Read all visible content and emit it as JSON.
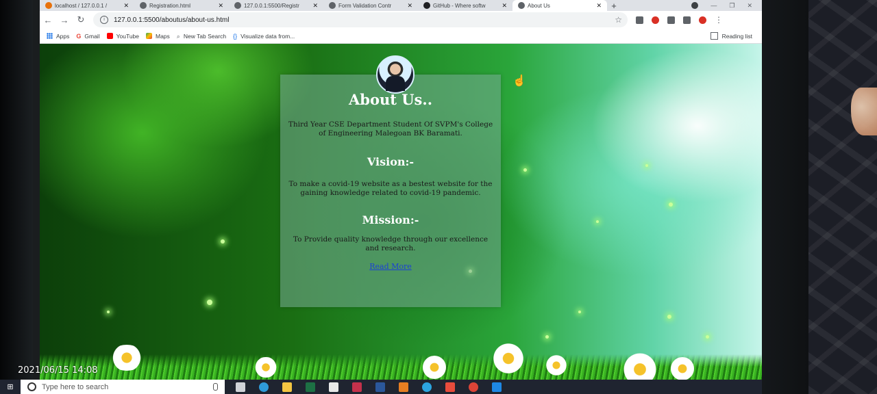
{
  "browser": {
    "tabs": [
      {
        "label": "localhost / 127.0.0.1 /",
        "active": false
      },
      {
        "label": "Registration.html",
        "active": false
      },
      {
        "label": "127.0.0.1:5500/Registr",
        "active": false
      },
      {
        "label": "Form Validation Contr",
        "active": false
      },
      {
        "label": "GitHub - Where softw",
        "active": false
      },
      {
        "label": "About Us",
        "active": true
      }
    ],
    "new_tab": "+",
    "url": "127.0.0.1:5500/aboutus/about-us.html",
    "bookmarks": [
      "Apps",
      "Gmail",
      "YouTube",
      "Maps",
      "New Tab Search",
      "Visualize data from..."
    ],
    "reading_list": "Reading list"
  },
  "page": {
    "title": "About Us..",
    "intro": "Third Year CSE Department Student Of SVPM's College of Engineering Malegoan BK Baramati.",
    "vision_heading": "Vision:-",
    "vision_text": "To make a covid-19 website as a bestest website for the gaining knowledge related to covid-19 pandemic.",
    "mission_heading": "Mission:-",
    "mission_text": "To Provide quality knowledge through our excellence and research.",
    "read_more": "Read More"
  },
  "taskbar": {
    "search_placeholder": "Type here to search"
  },
  "photo_timestamp": "2021/06/15 14:08",
  "colors": {
    "card_bg": "#78aa96",
    "heading": "#ffffff",
    "link": "#1a3fd6",
    "tabstrip": "#dee1e6"
  }
}
